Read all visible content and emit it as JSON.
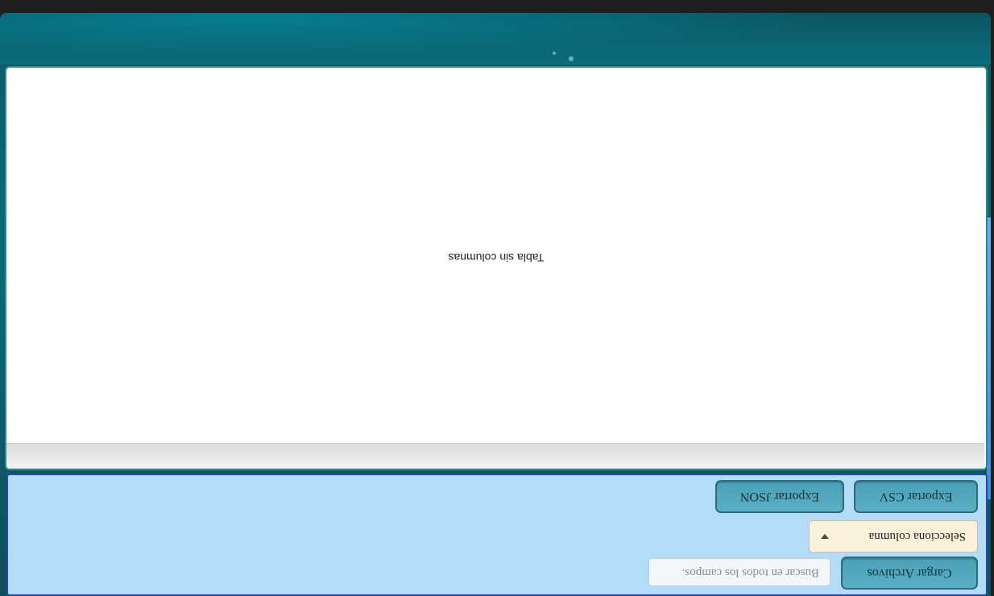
{
  "toolbar": {
    "load_label": "Cargar Archivos",
    "search_placeholder": "Buscar en todos los campos.",
    "column_select_value": "Selecciona columna",
    "export_csv_label": "Exportar CSV",
    "export_json_label": "Exportar JSON"
  },
  "table": {
    "empty_message": "Tabla sin columnas"
  },
  "colors": {
    "toolbar_bg": "#b2dcf8",
    "button_bg": "#4a9fb6",
    "select_bg": "#fbf1da",
    "window_accent": "#0b6a78"
  }
}
